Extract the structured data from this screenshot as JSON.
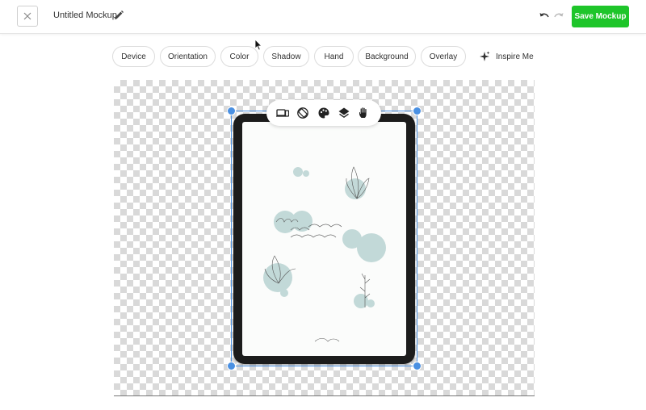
{
  "header": {
    "title": "Untitled Mockup",
    "save_label": "Save Mockup",
    "icons": [
      "close-icon",
      "pencil-icon",
      "undo-icon",
      "redo-icon"
    ]
  },
  "toolbar": {
    "chips": [
      "Device",
      "Orientation",
      "Color",
      "Shadow",
      "Hand",
      "Background",
      "Overlay"
    ],
    "inspire_label": "Inspire Me"
  },
  "device_toolbar": {
    "icons": [
      "devices-icon",
      "rotate-icon",
      "palette-icon",
      "layers-icon",
      "hand-icon"
    ]
  },
  "colors": {
    "accent_green": "#1ec52a",
    "selection_blue": "#4a90e2",
    "device_frame": "#1c1c1c",
    "artwork_teal": "#b9d3d2"
  }
}
